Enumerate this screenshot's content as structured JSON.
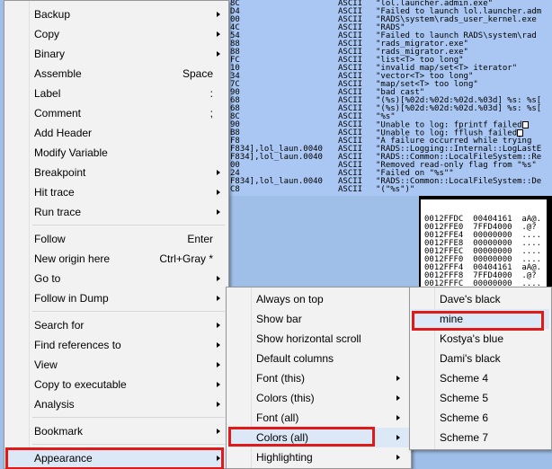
{
  "dump_rows": [
    {
      "addr": "8C",
      "type": "ASCII",
      "text": "\"lol.launcher.admin.exe\""
    },
    {
      "addr": "D4",
      "type": "ASCII",
      "text": "\"Failed to launch lol.launcher.adm"
    },
    {
      "addr": "00",
      "type": "ASCII",
      "text": "\"RADS\\system\\rads_user_kernel.exe"
    },
    {
      "addr": "4C",
      "type": "ASCII",
      "text": "\"RADS\""
    },
    {
      "addr": "54",
      "type": "ASCII",
      "text": "\"Failed to launch RADS\\system\\rad"
    },
    {
      "addr": "88",
      "type": "ASCII",
      "text": "\"rads_migrator.exe\""
    },
    {
      "addr": "88",
      "type": "ASCII",
      "text": "\"rads_migrator.exe\""
    },
    {
      "addr": "FC",
      "type": "ASCII",
      "text": "\"list<T> too long\""
    },
    {
      "addr": "10",
      "type": "ASCII",
      "text": "\"invalid map/set<T> iterator\""
    },
    {
      "addr": "34",
      "type": "ASCII",
      "text": "\"vector<T> too long\""
    },
    {
      "addr": "7C",
      "type": "ASCII",
      "text": "\"map/set<T> too long\""
    },
    {
      "addr": "90",
      "type": "ASCII",
      "text": "\"bad cast\""
    },
    {
      "addr": "68",
      "type": "ASCII",
      "text": "\"(%s)[%02d:%02d:%02d.%03d] %s: %s["
    },
    {
      "addr": "68",
      "type": "ASCII",
      "text": "\"(%s)[%02d:%02d:%02d.%03d] %s: %s["
    },
    {
      "addr": "8C",
      "type": "ASCII",
      "text": "\"%s\""
    },
    {
      "addr": "90",
      "type": "ASCII",
      "text": "\"Unable to log: fprintf failed",
      "box": true
    },
    {
      "addr": "B8",
      "type": "ASCII",
      "text": "\"Unable to log: fflush failed",
      "box": true
    },
    {
      "addr": "F8",
      "type": "ASCII",
      "text": "\"A failure occurred while trying "
    },
    {
      "addr": "F834],lol_laun.0040",
      "type": "ASCII",
      "text": "\"RADS::Logging::Internal::LogLastE"
    },
    {
      "addr": "F834],lol_laun.0040",
      "type": "ASCII",
      "text": "\"RADS::Common::LocalFileSystem::Re"
    },
    {
      "addr": "00",
      "type": "ASCII",
      "text": "\"Removed read-only flag from \"%s\""
    },
    {
      "addr": "24",
      "type": "ASCII",
      "text": "\"Failed on \"%s\"\""
    },
    {
      "addr": "F834],lol_laun.0040",
      "type": "ASCII",
      "text": "\"RADS::Common::LocalFileSystem::De"
    },
    {
      "addr": "C8",
      "type": "ASCII",
      "text": "\"(\"%s\")\""
    }
  ],
  "stack_rows": [
    "0012FFDC  00404161  aA@.",
    "0012FFE0  7FFD4000  .@?",
    "0012FFE4  00000000  ....",
    "0012FFE8  00000000  ....",
    "0012FFEC  00000000  ....",
    "0012FFF0  00000000  ....",
    "0012FFF4  00404161  aA@.",
    "0012FFF8  7FFD4000  .@?",
    "0012FFFC  00000000  ...."
  ],
  "menu1": [
    {
      "label": "Backup",
      "arrow": true
    },
    {
      "label": "Copy",
      "arrow": true
    },
    {
      "label": "Binary",
      "arrow": true
    },
    {
      "label": "Assemble",
      "shortcut": "Space"
    },
    {
      "label": "Label",
      "shortcut": ":"
    },
    {
      "label": "Comment",
      "shortcut": ";"
    },
    {
      "label": "Add Header"
    },
    {
      "label": "Modify Variable"
    },
    {
      "label": "Breakpoint",
      "arrow": true
    },
    {
      "label": "Hit trace",
      "arrow": true
    },
    {
      "label": "Run trace",
      "arrow": true
    },
    {
      "sep": true
    },
    {
      "label": "Follow",
      "shortcut": "Enter"
    },
    {
      "label": "New origin here",
      "shortcut": "Ctrl+Gray *"
    },
    {
      "label": "Go to",
      "arrow": true
    },
    {
      "label": "Follow in Dump",
      "arrow": true
    },
    {
      "sep": true
    },
    {
      "label": "Search for",
      "arrow": true
    },
    {
      "label": "Find references to",
      "arrow": true
    },
    {
      "label": "View",
      "arrow": true
    },
    {
      "label": "Copy to executable",
      "arrow": true
    },
    {
      "label": "Analysis",
      "arrow": true
    },
    {
      "sep": true
    },
    {
      "label": "Bookmark",
      "arrow": true
    },
    {
      "sep": true
    },
    {
      "label": "Appearance",
      "arrow": true,
      "active": true
    }
  ],
  "menu2": [
    {
      "label": "Always on top"
    },
    {
      "label": "Show bar"
    },
    {
      "label": "Show horizontal scroll"
    },
    {
      "label": "Default columns"
    },
    {
      "label": "Font (this)",
      "arrow": true
    },
    {
      "label": "Colors (this)",
      "arrow": true
    },
    {
      "label": "Font (all)",
      "arrow": true
    },
    {
      "label": "Colors (all)",
      "arrow": true,
      "active": true
    },
    {
      "label": "Highlighting",
      "arrow": true
    }
  ],
  "menu3": [
    {
      "label": "Dave's black"
    },
    {
      "label": "mine",
      "active": true
    },
    {
      "label": "Kostya's blue"
    },
    {
      "label": "Dami's black"
    },
    {
      "label": "Scheme 4"
    },
    {
      "label": "Scheme 5"
    },
    {
      "label": "Scheme 6"
    },
    {
      "label": "Scheme 7"
    }
  ],
  "colors": {
    "highlight_border": "#e01919",
    "menu_bg": "#f2f2f2",
    "dump_bg": "#a9c7f2"
  }
}
